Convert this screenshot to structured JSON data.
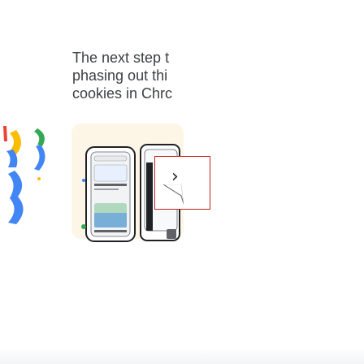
{
  "article": {
    "headline_lines": [
      "The next step t",
      "phasing out thi",
      "cookies in Chrc"
    ]
  },
  "carousel": {
    "next_button_label": "›",
    "next_button_icon": "chevron-right-icon"
  },
  "colors": {
    "headline": "#3c4043",
    "card_bg": "#fdf6e6",
    "google_blue": "#4285f4",
    "google_red": "#ea4335",
    "google_yellow": "#fbbc04",
    "google_green": "#34a853",
    "next_button_border": "#c5221f"
  }
}
